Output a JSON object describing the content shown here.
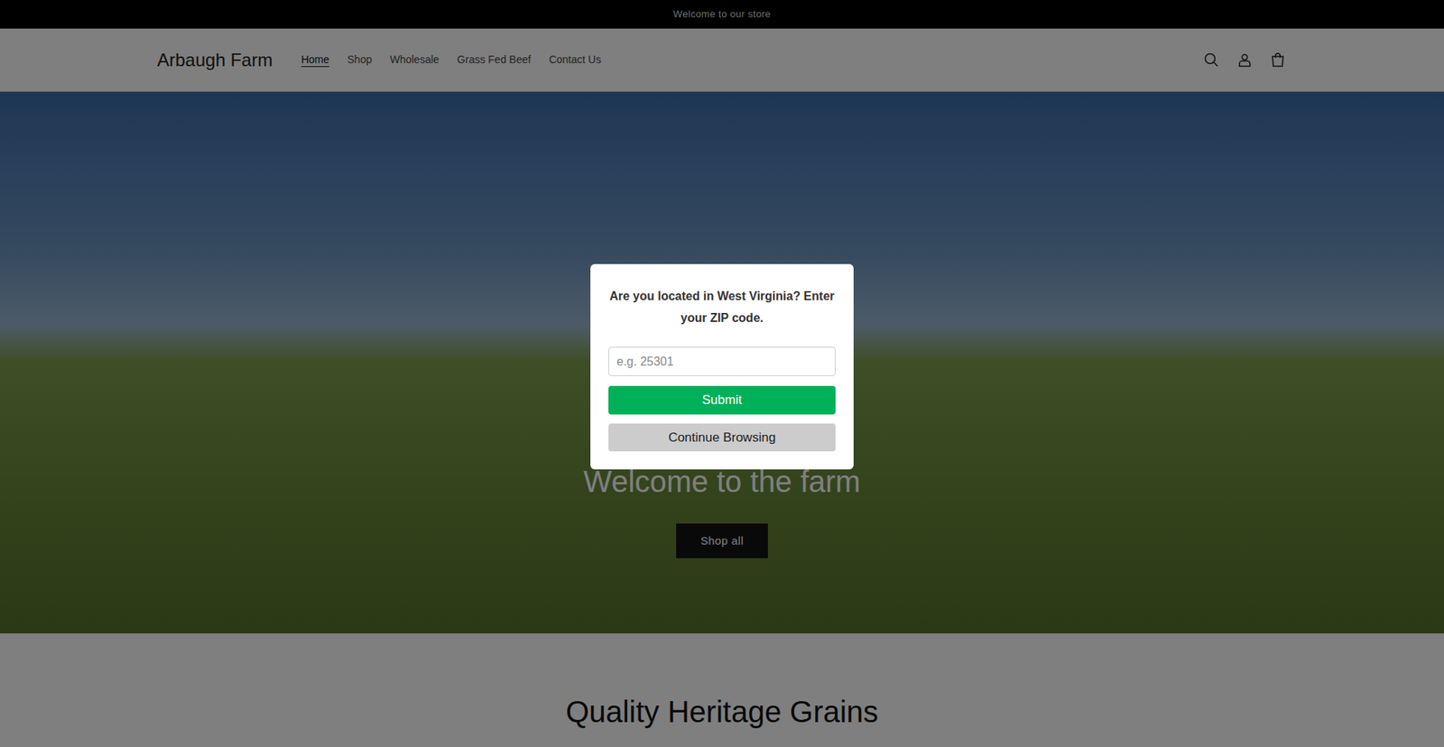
{
  "announcement": "Welcome to our store",
  "header": {
    "logo": "Arbaugh Farm",
    "nav": [
      {
        "label": "Home",
        "selected": true
      },
      {
        "label": "Shop",
        "selected": false
      },
      {
        "label": "Wholesale",
        "selected": false
      },
      {
        "label": "Grass Fed Beef",
        "selected": false
      },
      {
        "label": "Contact Us",
        "selected": false
      }
    ]
  },
  "hero": {
    "heading": "Welcome to the farm",
    "button": "Shop all"
  },
  "section": {
    "heading": "Quality Heritage Grains"
  },
  "modal": {
    "prompt": "Are you located in West Virginia? Enter your ZIP code.",
    "input_placeholder": "e.g. 25301",
    "buttons": [
      "Submit",
      "Continue Browsing"
    ]
  }
}
